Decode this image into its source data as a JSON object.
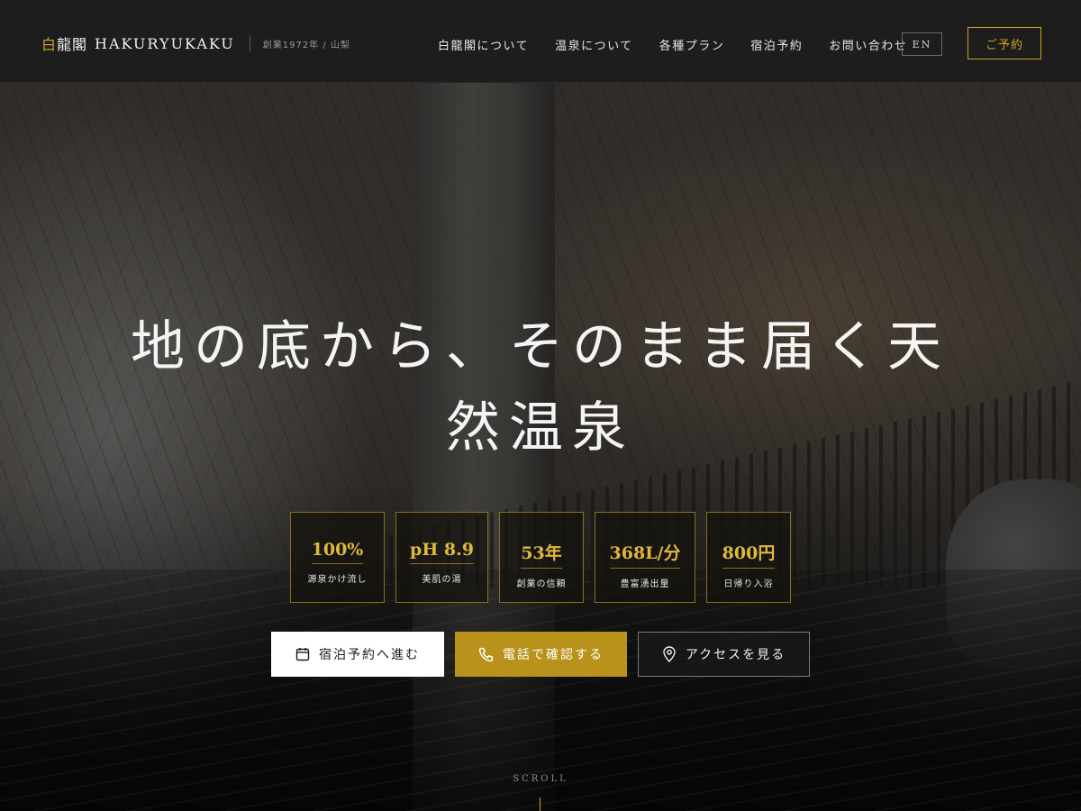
{
  "header": {
    "brand": {
      "kanji_first": "白",
      "kanji_rest": "龍閣",
      "roman": "HAKURYUKAKU",
      "sub": "創業1972年 / 山梨"
    },
    "nav": [
      {
        "label": "白龍閣について"
      },
      {
        "label": "温泉について"
      },
      {
        "label": "各種プラン"
      },
      {
        "label": "宿泊予約"
      },
      {
        "label": "お問い合わせ"
      }
    ],
    "lang_label": "EN",
    "reserve_label": "ご予約"
  },
  "hero": {
    "headline_line1": "地の底から、そのまま届く天",
    "headline_line2": "然温泉",
    "stats": [
      {
        "value": "100%",
        "label": "源泉かけ流し"
      },
      {
        "value": "pH 8.9",
        "label": "美肌の湯"
      },
      {
        "value": "53年",
        "label": "創業の信頼"
      },
      {
        "value": "368L/分",
        "label": "豊富湧出量"
      },
      {
        "value": "800円",
        "label": "日帰り入浴"
      }
    ],
    "cta": {
      "book_label": "宿泊予約へ進む",
      "phone_label": "電話で確認する",
      "access_label": "アクセスを見る"
    },
    "scroll_label": "SCROLL"
  },
  "colors": {
    "gold": "#c9a227",
    "gold_button": "#b8921a",
    "header_bg": "#1d1d1d"
  },
  "icons": {
    "book": "calendar-icon",
    "phone": "phone-icon",
    "access": "map-pin-icon"
  }
}
